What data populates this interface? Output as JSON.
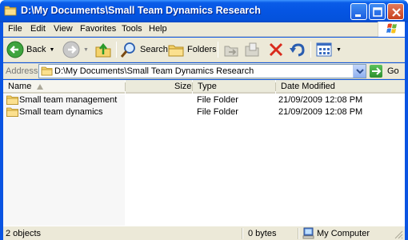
{
  "window": {
    "title": "D:\\My Documents\\Small Team Dynamics Research"
  },
  "menu": [
    "File",
    "Edit",
    "View",
    "Favorites",
    "Tools",
    "Help"
  ],
  "toolbar": {
    "back_label": "Back",
    "search_label": "Search",
    "folders_label": "Folders"
  },
  "address": {
    "label": "Address",
    "value": "D:\\My Documents\\Small Team Dynamics Research",
    "go_label": "Go"
  },
  "columns": {
    "name": "Name",
    "size": "Size",
    "type": "Type",
    "date": "Date Modified"
  },
  "files": [
    {
      "name": "Small team management",
      "size": "",
      "type": "File Folder",
      "date": "21/09/2009 12:08 PM"
    },
    {
      "name": "Small team dynamics",
      "size": "",
      "type": "File Folder",
      "date": "21/09/2009 12:08 PM"
    }
  ],
  "status": {
    "objects": "2 objects",
    "size": "0 bytes",
    "location": "My Computer"
  },
  "colors": {
    "titlebar": "#0555e3",
    "chrome": "#ece9d8",
    "close_button": "#c8401c"
  }
}
